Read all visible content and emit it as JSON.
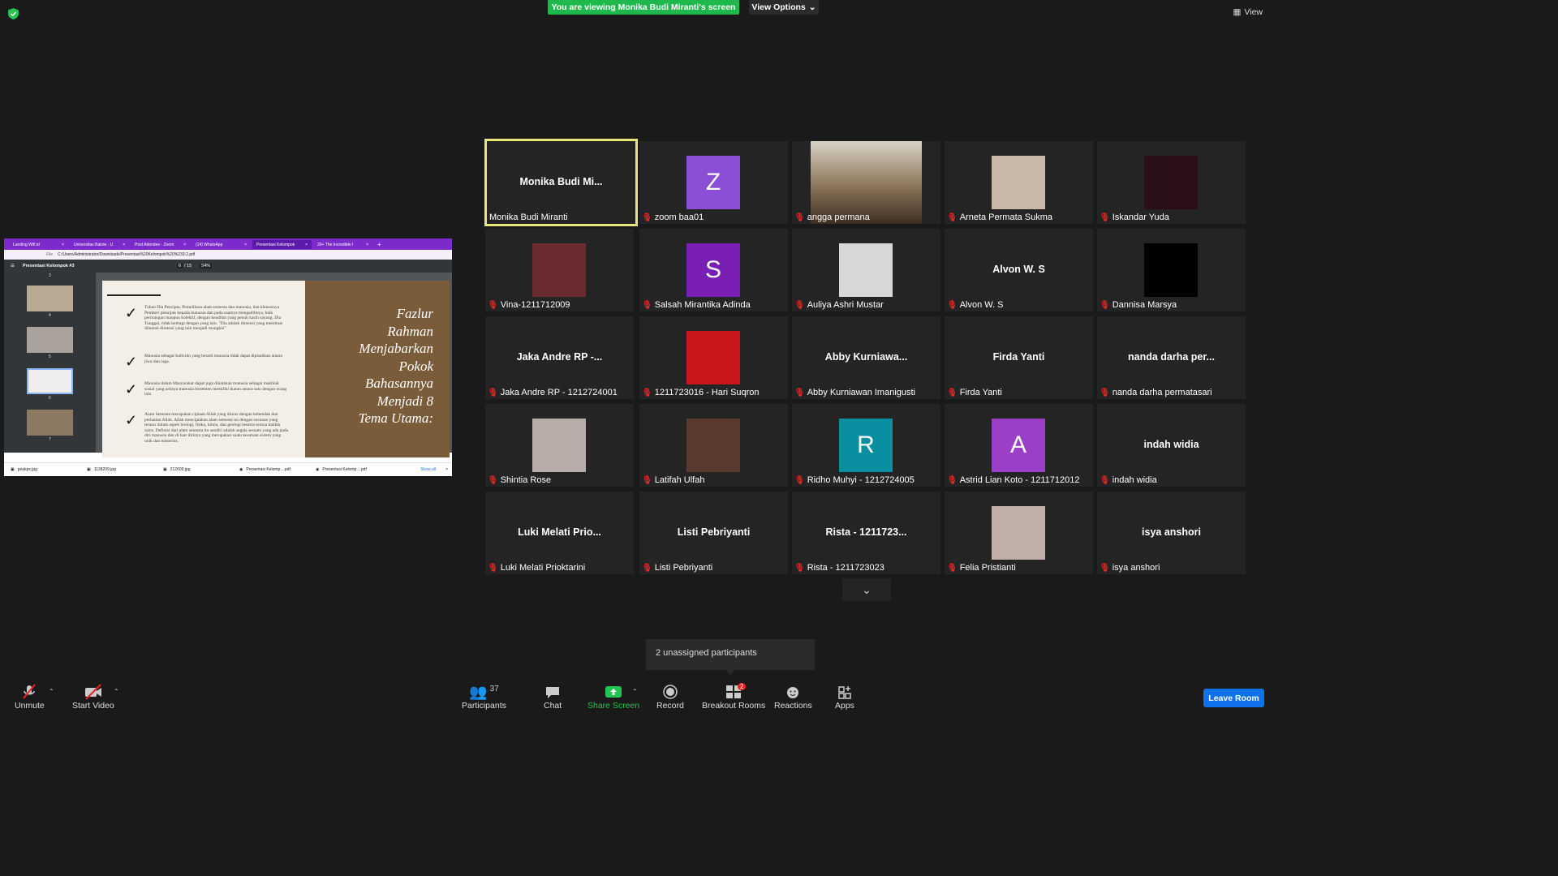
{
  "top": {
    "banner": "You are viewing Monika Budi Miranti's screen",
    "view_options": "View Options",
    "view": "View"
  },
  "share": {
    "tabs": [
      "Landing Wifi.id",
      "Universitas Bakrie - U",
      "Post Attendee - Zoom",
      "(14) WhatsApp",
      "Presentasi Kelompok",
      "20+ The Incredible I"
    ],
    "address": "C:/Users/Administrator/Downloads/Presentasi%20Kelompok%20%233-2.pdf",
    "address_prefix": "File",
    "pdf_title": "Presentasi Kelompok #3",
    "page": "6",
    "page_total": "/ 15",
    "zoom": "54%",
    "thumb_labels": [
      "3",
      "4",
      "5",
      "6",
      "7"
    ],
    "bullets": [
      "Tuhan Dia Pencipta, Pemelihara alam semesta dan manusia, dan khususnya Pemberi petunjuk kepada manusia dan pada saatnya mengadilinya, baik perorangan maupun kolektif, dengan keadilan yang penuh kasih sayang. Dia Tunggal, tidak berbagi dengan yang lain. \"Dia adalah dimensi yang membuat dimensi-dimensi yang lain menjadi mungkin\"",
      "Manusia sebagai Individu yang berarti manusia tidak dapat dipisahkan antara jiwa dan raga.",
      "Manusia dalam Masyarakat dapat juga dikatakan manusia sebagai makhluk sosial yang artinya manusia bertemen memiliki ikatan antara satu dengan orang lain",
      "Alam Semesta merupakan ciptaan Allah yang diurus dengan kehendak dan perhatian Allah. Allah menciptakan alam semesta ini dengan susunan yang teratur dalam aspek biologi, fisika, kimia, dan geologi beserta semua kaidah sains. Definisi dari alam semesta itu sendiri adalah segala sesuatu yang ada pada diri manusia dan di luar dirinya yang merupakan suatu kesatuan sistem yang unik dan misterius."
    ],
    "slide_title": [
      "Fazlur",
      "Rahman",
      "Menjabarkan",
      "Pokok",
      "Bahasannya",
      "Menjadi 8",
      "Tema Utama:"
    ],
    "downloads": [
      "peakpx.jpg",
      "1138209.jpg",
      "212609.jpg",
      "Presentasi Kelomp....pdf",
      "Presentasi Kelomp....pdf"
    ],
    "show_all": "Show all"
  },
  "participants": [
    {
      "display": "Monika Budi Mi...",
      "name": "Monika Budi Miranti",
      "type": "name",
      "active": true
    },
    {
      "display": "Z",
      "name": "zoom baa01",
      "type": "letter",
      "color": "#8a4fd6"
    },
    {
      "display": "",
      "name": "angga permana",
      "type": "video",
      "color": "#9a8a70"
    },
    {
      "display": "",
      "name": "Arneta Permata Sukma",
      "type": "photo",
      "color": "#c8b8a8"
    },
    {
      "display": "",
      "name": "Iskandar Yuda",
      "type": "photo",
      "color": "#2a0e18"
    },
    {
      "display": "",
      "name": "Vina-1211712009",
      "type": "photo",
      "color": "#6a2a30"
    },
    {
      "display": "S",
      "name": "Salsah Mirantika Adinda",
      "type": "letter",
      "color": "#7a1fb4"
    },
    {
      "display": "",
      "name": "Auliya Ashri Mustar",
      "type": "photo",
      "color": "#d8d8d8"
    },
    {
      "display": "Alvon W. S",
      "name": "Alvon W. S",
      "type": "name"
    },
    {
      "display": "",
      "name": "Dannisa Marsya",
      "type": "photo",
      "color": "#000000"
    },
    {
      "display": "Jaka Andre RP -...",
      "name": "Jaka Andre RP - 1212724001",
      "type": "name"
    },
    {
      "display": "",
      "name": "1211723016 - Hari Suqron",
      "type": "photo",
      "color": "#c8161c"
    },
    {
      "display": "Abby Kurniawa...",
      "name": "Abby Kurniawan Imanigusti",
      "type": "name"
    },
    {
      "display": "Firda Yanti",
      "name": "Firda Yanti",
      "type": "name"
    },
    {
      "display": "nanda darha per...",
      "name": "nanda darha permatasari",
      "type": "name"
    },
    {
      "display": "",
      "name": "Shintia Rose",
      "type": "photo",
      "color": "#b8aca8"
    },
    {
      "display": "",
      "name": "Latifah Ulfah",
      "type": "photo",
      "color": "#5a3a30"
    },
    {
      "display": "R",
      "name": "Ridho Muhyi - 1212724005",
      "type": "letter",
      "color": "#0a8fa0"
    },
    {
      "display": "A",
      "name": "Astrid Lian Koto - 1211712012",
      "type": "letter",
      "color": "#9b3fc8"
    },
    {
      "display": "indah widia",
      "name": "indah widia",
      "type": "name"
    },
    {
      "display": "Luki Melati Prio...",
      "name": "Luki Melati Prioktarini",
      "type": "name"
    },
    {
      "display": "Listi Pebriyanti",
      "name": "Listi Pebriyanti",
      "type": "name"
    },
    {
      "display": "Rista - 1211723...",
      "name": "Rista - 1211723023",
      "type": "name"
    },
    {
      "display": "",
      "name": "Felia Pristianti",
      "type": "photo",
      "color": "#c0b0a8"
    },
    {
      "display": "isya anshori",
      "name": "isya anshori",
      "type": "name"
    }
  ],
  "unassigned": "2 unassigned participants",
  "toolbar": {
    "unmute": "Unmute",
    "start_video": "Start Video",
    "participants": "Participants",
    "participants_count": "37",
    "chat": "Chat",
    "share_screen": "Share Screen",
    "record": "Record",
    "breakout_rooms": "Breakout Rooms",
    "breakout_badge": "2",
    "reactions": "Reactions",
    "apps": "Apps",
    "leave_room": "Leave Room"
  },
  "colors": {
    "banner_green": "#1fb84d",
    "leave_blue": "#0e72ed",
    "active_border": "#e6e67a",
    "muted_red": "#e22222"
  }
}
